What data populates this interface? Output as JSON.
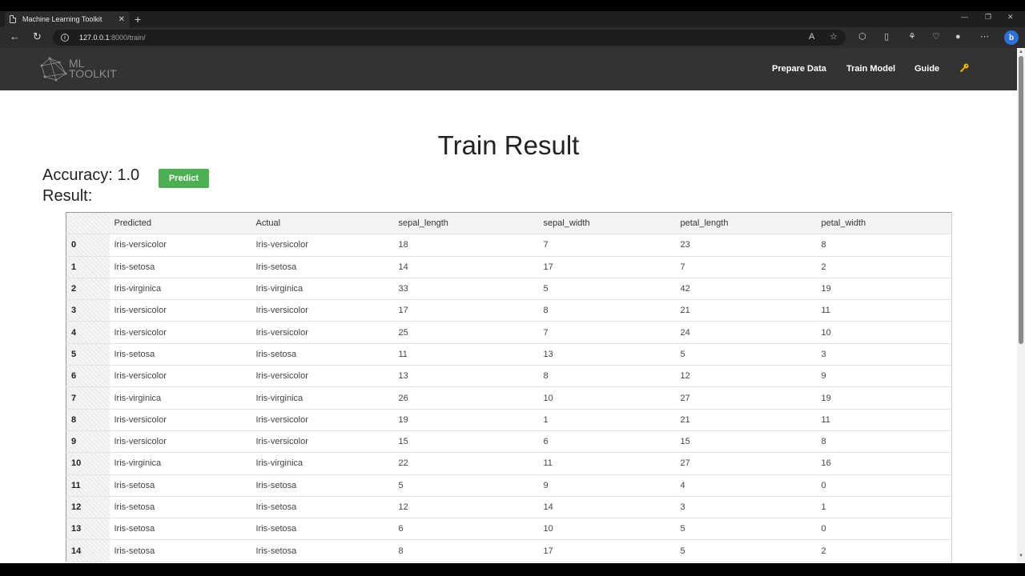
{
  "browser": {
    "tab_title": "Machine Learning Toolkit",
    "url_host": "127.0.0.1",
    "url_rest": ":8000/train/"
  },
  "site": {
    "logo_line1": "ML",
    "logo_line2": "TOOLKIT",
    "nav": [
      {
        "label": "Prepare Data"
      },
      {
        "label": "Train Model"
      },
      {
        "label": "Guide"
      }
    ],
    "icons": {
      "account": "key-icon"
    }
  },
  "page": {
    "title": "Train Result",
    "accuracy_label": "Accuracy: 1.0",
    "predict_label": "Predict",
    "result_label": "Result:"
  },
  "table": {
    "columns": [
      "",
      "Predicted",
      "Actual",
      "sepal_length",
      "sepal_width",
      "petal_length",
      "petal_width"
    ],
    "rows": [
      [
        "0",
        "Iris-versicolor",
        "Iris-versicolor",
        "18",
        "7",
        "23",
        "8"
      ],
      [
        "1",
        "Iris-setosa",
        "Iris-setosa",
        "14",
        "17",
        "7",
        "2"
      ],
      [
        "2",
        "Iris-virginica",
        "Iris-virginica",
        "33",
        "5",
        "42",
        "19"
      ],
      [
        "3",
        "Iris-versicolor",
        "Iris-versicolor",
        "17",
        "8",
        "21",
        "11"
      ],
      [
        "4",
        "Iris-versicolor",
        "Iris-versicolor",
        "25",
        "7",
        "24",
        "10"
      ],
      [
        "5",
        "Iris-setosa",
        "Iris-setosa",
        "11",
        "13",
        "5",
        "3"
      ],
      [
        "6",
        "Iris-versicolor",
        "Iris-versicolor",
        "13",
        "8",
        "12",
        "9"
      ],
      [
        "7",
        "Iris-virginica",
        "Iris-virginica",
        "26",
        "10",
        "27",
        "19"
      ],
      [
        "8",
        "Iris-versicolor",
        "Iris-versicolor",
        "19",
        "1",
        "21",
        "11"
      ],
      [
        "9",
        "Iris-versicolor",
        "Iris-versicolor",
        "15",
        "6",
        "15",
        "8"
      ],
      [
        "10",
        "Iris-virginica",
        "Iris-virginica",
        "22",
        "11",
        "27",
        "16"
      ],
      [
        "11",
        "Iris-setosa",
        "Iris-setosa",
        "5",
        "9",
        "4",
        "0"
      ],
      [
        "12",
        "Iris-setosa",
        "Iris-setosa",
        "12",
        "14",
        "3",
        "1"
      ],
      [
        "13",
        "Iris-setosa",
        "Iris-setosa",
        "6",
        "10",
        "5",
        "0"
      ],
      [
        "14",
        "Iris-setosa",
        "Iris-setosa",
        "8",
        "17",
        "5",
        "2"
      ]
    ]
  },
  "colors": {
    "header_bg": "#333333",
    "predict_button": "#4caf50",
    "key_icon": "#f2b705"
  }
}
